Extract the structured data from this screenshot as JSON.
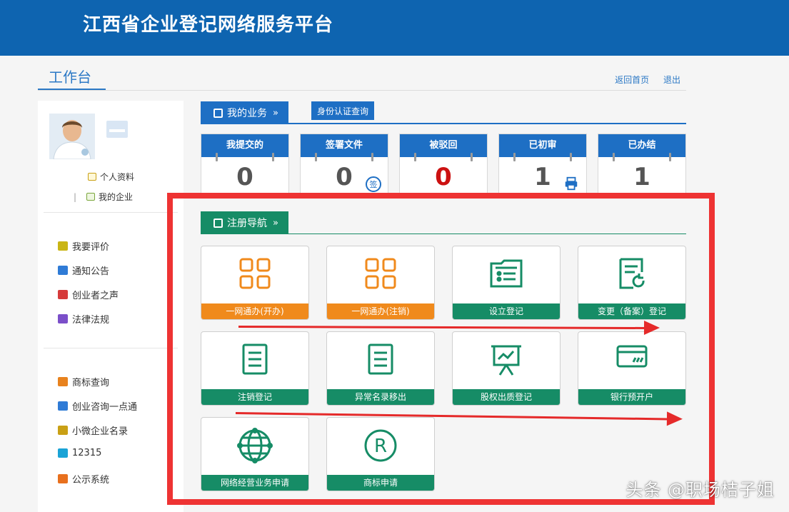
{
  "header": {
    "title": "江西省企业登记网络服务平台"
  },
  "workbench": {
    "title": "工作台"
  },
  "top_links": {
    "home": "返回首页",
    "logout": "退出"
  },
  "sidebar": {
    "profile_link": "个人资料",
    "company_link": "我的企业",
    "group1": [
      {
        "label": "我要评价",
        "icon": "envelope-icon",
        "color": "#c9b515"
      },
      {
        "label": "通知公告",
        "icon": "chat-icon",
        "color": "#2f7bd6"
      },
      {
        "label": "创业者之声",
        "icon": "mail-icon",
        "color": "#d63b3b"
      },
      {
        "label": "法律法规",
        "icon": "books-icon",
        "color": "#7b4fc9"
      }
    ],
    "group2": [
      {
        "label": "商标查询",
        "icon": "trademark-icon",
        "color": "#e8821e"
      },
      {
        "label": "创业咨询一点通",
        "icon": "grid-icon",
        "color": "#2f7bd6"
      },
      {
        "label": "小微企业名录",
        "icon": "list-icon",
        "color": "#c9a015"
      },
      {
        "label": "12315",
        "icon": "monitor-icon",
        "color": "#1aa3d6"
      },
      {
        "label": "公示系统",
        "icon": "document-icon",
        "color": "#e8701e"
      }
    ]
  },
  "my_business": {
    "tab_label": "我的业务",
    "id_query_button": "身份认证查询"
  },
  "stats": [
    {
      "label": "我提交的",
      "value": "0",
      "icon": ""
    },
    {
      "label": "签署文件",
      "value": "0",
      "icon": "sign-icon"
    },
    {
      "label": "被驳回",
      "value": "0",
      "icon": ""
    },
    {
      "label": "已初审",
      "value": "1",
      "icon": "printer-icon"
    },
    {
      "label": "已办结",
      "value": "1",
      "icon": ""
    }
  ],
  "registration_nav": {
    "tab_label": "注册导航",
    "items": [
      {
        "label": "一网通办(开办)",
        "icon": "apps-grid-icon",
        "style": "orange"
      },
      {
        "label": "一网通办(注销)",
        "icon": "apps-grid-icon",
        "style": "orange"
      },
      {
        "label": "设立登记",
        "icon": "folder-list-icon",
        "style": "green"
      },
      {
        "label": "变更（备案）登记",
        "icon": "doc-refresh-icon",
        "style": "green"
      },
      {
        "label": "注销登记",
        "icon": "doc-lines-icon",
        "style": "green"
      },
      {
        "label": "异常名录移出",
        "icon": "doc-lines-icon",
        "style": "green"
      },
      {
        "label": "股权出质登记",
        "icon": "presentation-icon",
        "style": "green"
      },
      {
        "label": "银行预开户",
        "icon": "card-icon",
        "style": "green"
      },
      {
        "label": "网络经营业务申请",
        "icon": "globe-icon",
        "style": "green"
      },
      {
        "label": "商标申请",
        "icon": "registered-icon",
        "style": "green"
      }
    ]
  },
  "colors": {
    "header_blue": "#0e64b0",
    "tab_blue": "#1e6fc4",
    "green": "#168c66",
    "orange": "#f08a1c",
    "annotation_red": "#ee3333"
  },
  "watermark": "头条 @职场桔子姐"
}
